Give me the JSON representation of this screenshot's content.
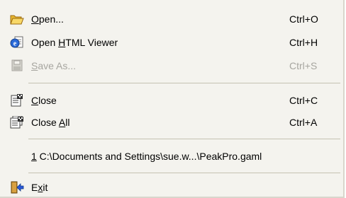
{
  "menu": {
    "items": [
      {
        "label_pre": "",
        "mnemonic": "O",
        "label_post": "pen...",
        "shortcut": "Ctrl+O",
        "icon": "open-folder-icon",
        "enabled": true
      },
      {
        "label_pre": "Open ",
        "mnemonic": "H",
        "label_post": "TML Viewer",
        "shortcut": "Ctrl+H",
        "icon": "html-viewer-icon",
        "enabled": true
      },
      {
        "label_pre": "",
        "mnemonic": "S",
        "label_post": "ave As...",
        "shortcut": "Ctrl+S",
        "icon": "floppy-disk-icon",
        "enabled": false
      },
      {
        "label_pre": "",
        "mnemonic": "C",
        "label_post": "lose",
        "shortcut": "Ctrl+C",
        "icon": "close-document-icon",
        "enabled": true
      },
      {
        "label_pre": "Close ",
        "mnemonic": "A",
        "label_post": "ll",
        "shortcut": "Ctrl+A",
        "icon": "close-all-documents-icon",
        "enabled": true
      }
    ],
    "recent": {
      "mnemonic": "1",
      "path": " C:\\Documents and Settings\\sue.w...\\PeakPro.gaml"
    },
    "exit": {
      "label_pre": "E",
      "mnemonic": "x",
      "label_post": "it",
      "icon": "exit-door-icon"
    }
  },
  "colors": {
    "menu_background": "#f4f3ee",
    "separator": "#c5c2b2",
    "disabled_text": "#a7a6a0"
  }
}
